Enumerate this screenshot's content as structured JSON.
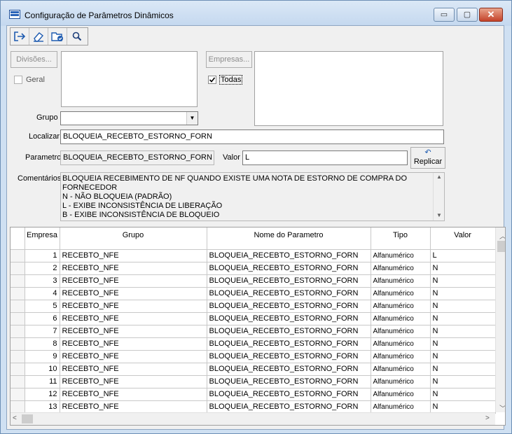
{
  "window": {
    "title": "Configuração de Parâmetros Dinâmicos",
    "minimize": "▭",
    "maximize": "▢",
    "close": "✕"
  },
  "toolbar": {
    "icons": [
      "exit-icon",
      "eraser-icon",
      "folder-check-icon",
      "search-icon"
    ]
  },
  "form": {
    "divisoes_button": "Divisões...",
    "empresas_button": "Empresas...",
    "geral_label": "Geral",
    "geral_checked": false,
    "todas_label": "Todas",
    "todas_checked": true,
    "grupo_label": "Grupo",
    "grupo_value": "",
    "localizar_label": "Localizar",
    "localizar_value": "BLOQUEIA_RECEBTO_ESTORNO_FORN",
    "parametro_label": "Parametro",
    "parametro_value": "BLOQUEIA_RECEBTO_ESTORNO_FORN",
    "valor_label": "Valor",
    "valor_value": "L",
    "replicar_label": "Replicar",
    "comentarios_label": "Comentários",
    "comentarios_lines": [
      "BLOQUEIA RECEBIMENTO DE NF QUANDO EXISTE UMA NOTA DE ESTORNO DE COMPRA DO",
      "FORNECEDOR",
      "N - NÃO BLOQUEIA (PADRÃO)",
      "L - EXIBE INCONSISTÊNCIA DE LIBERAÇÃO",
      "B - EXIBE INCONSISTÊNCIA DE BLOQUEIO"
    ]
  },
  "grid": {
    "columns": [
      "Empresa",
      "Grupo",
      "Nome do Parametro",
      "Tipo",
      "Valor"
    ],
    "rows": [
      {
        "empresa": "1",
        "grupo": "RECEBTO_NFE",
        "nome": "BLOQUEIA_RECEBTO_ESTORNO_FORN",
        "tipo": "Alfanumérico",
        "valor": "L"
      },
      {
        "empresa": "2",
        "grupo": "RECEBTO_NFE",
        "nome": "BLOQUEIA_RECEBTO_ESTORNO_FORN",
        "tipo": "Alfanumérico",
        "valor": "N"
      },
      {
        "empresa": "3",
        "grupo": "RECEBTO_NFE",
        "nome": "BLOQUEIA_RECEBTO_ESTORNO_FORN",
        "tipo": "Alfanumérico",
        "valor": "N"
      },
      {
        "empresa": "4",
        "grupo": "RECEBTO_NFE",
        "nome": "BLOQUEIA_RECEBTO_ESTORNO_FORN",
        "tipo": "Alfanumérico",
        "valor": "N"
      },
      {
        "empresa": "5",
        "grupo": "RECEBTO_NFE",
        "nome": "BLOQUEIA_RECEBTO_ESTORNO_FORN",
        "tipo": "Alfanumérico",
        "valor": "N"
      },
      {
        "empresa": "6",
        "grupo": "RECEBTO_NFE",
        "nome": "BLOQUEIA_RECEBTO_ESTORNO_FORN",
        "tipo": "Alfanumérico",
        "valor": "N"
      },
      {
        "empresa": "7",
        "grupo": "RECEBTO_NFE",
        "nome": "BLOQUEIA_RECEBTO_ESTORNO_FORN",
        "tipo": "Alfanumérico",
        "valor": "N"
      },
      {
        "empresa": "8",
        "grupo": "RECEBTO_NFE",
        "nome": "BLOQUEIA_RECEBTO_ESTORNO_FORN",
        "tipo": "Alfanumérico",
        "valor": "N"
      },
      {
        "empresa": "9",
        "grupo": "RECEBTO_NFE",
        "nome": "BLOQUEIA_RECEBTO_ESTORNO_FORN",
        "tipo": "Alfanumérico",
        "valor": "N"
      },
      {
        "empresa": "10",
        "grupo": "RECEBTO_NFE",
        "nome": "BLOQUEIA_RECEBTO_ESTORNO_FORN",
        "tipo": "Alfanumérico",
        "valor": "N"
      },
      {
        "empresa": "11",
        "grupo": "RECEBTO_NFE",
        "nome": "BLOQUEIA_RECEBTO_ESTORNO_FORN",
        "tipo": "Alfanumérico",
        "valor": "N"
      },
      {
        "empresa": "12",
        "grupo": "RECEBTO_NFE",
        "nome": "BLOQUEIA_RECEBTO_ESTORNO_FORN",
        "tipo": "Alfanumérico",
        "valor": "N"
      },
      {
        "empresa": "13",
        "grupo": "RECEBTO_NFE",
        "nome": "BLOQUEIA_RECEBTO_ESTORNO_FORN",
        "tipo": "Alfanumérico",
        "valor": "N"
      }
    ]
  }
}
